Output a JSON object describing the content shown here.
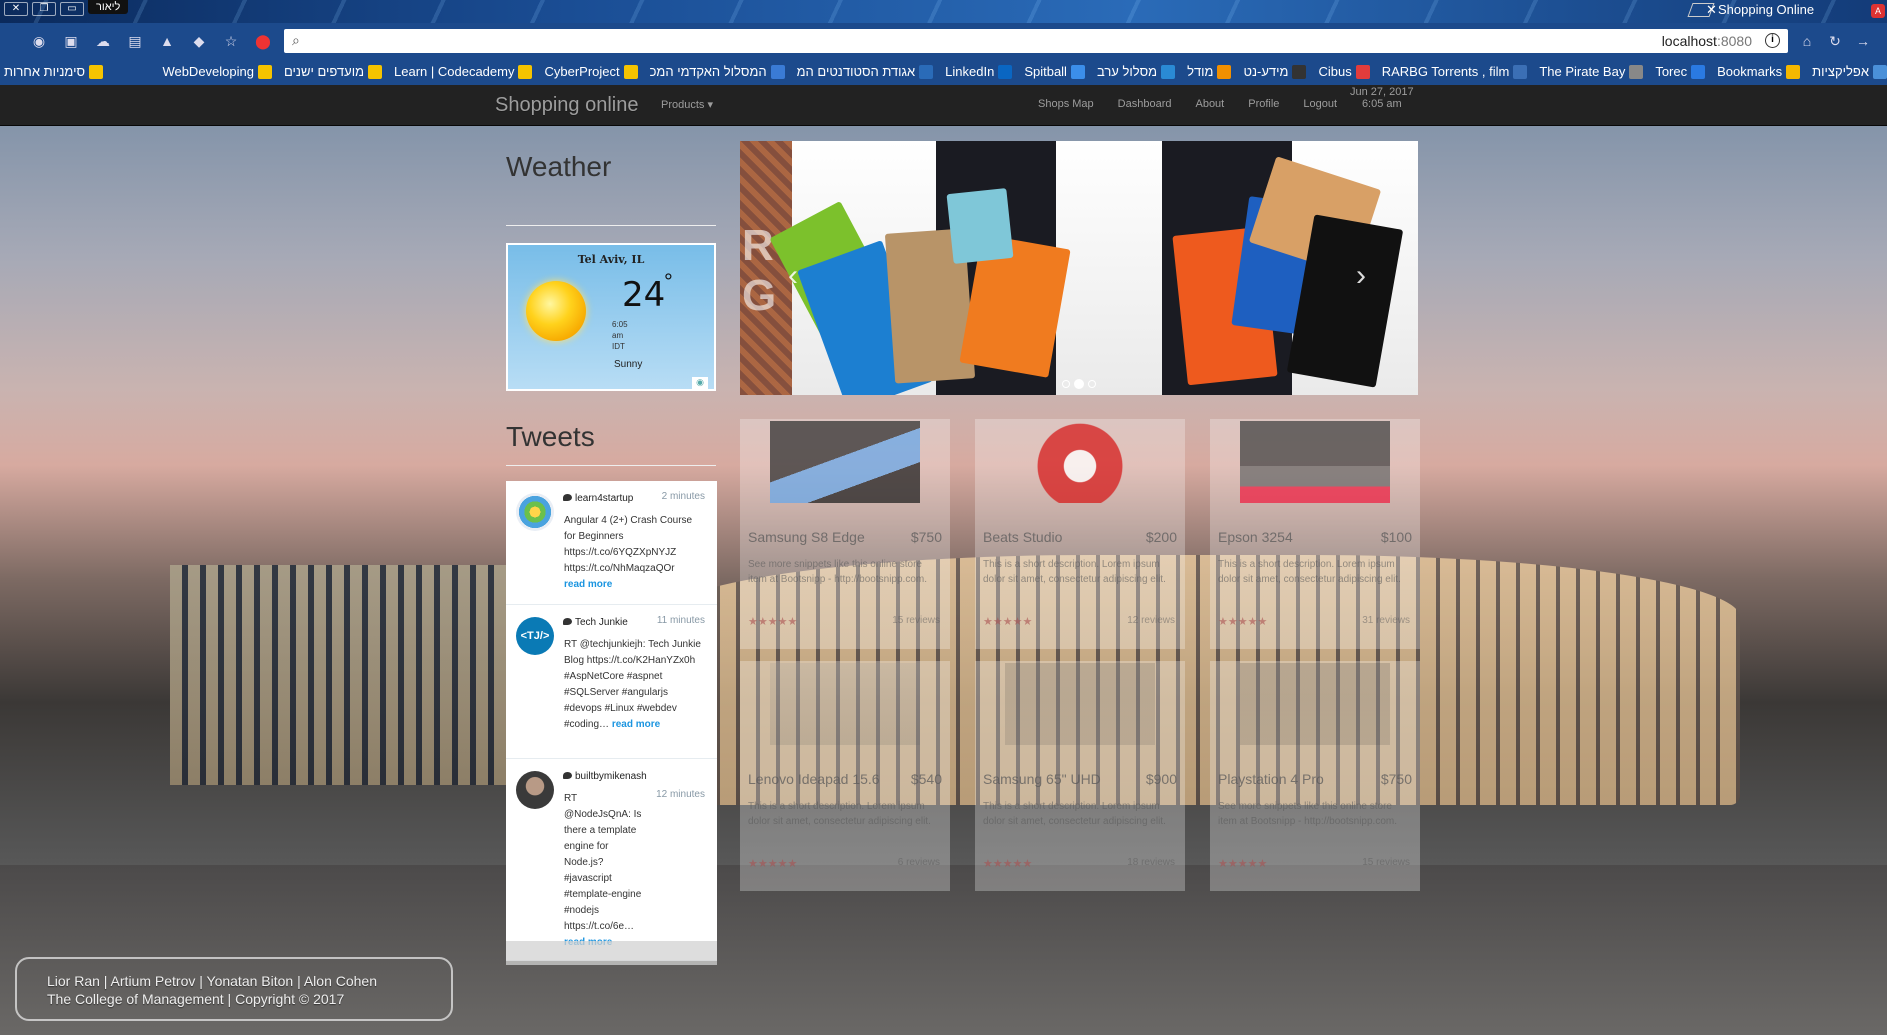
{
  "browser": {
    "profile_name": "ליאור",
    "tab_title": "Shopping Online",
    "url_host": "localhost",
    "url_port": ":8080",
    "bookmarks": [
      {
        "label": "אפליקציות",
        "icon_color": "#4a90d9"
      },
      {
        "label": "Bookmarks",
        "icon_color": "#f5b800"
      },
      {
        "label": "Torec",
        "icon_color": "#2a7ae2"
      },
      {
        "label": "The Pirate Bay",
        "icon_color": "#888888"
      },
      {
        "label": "RARBG Torrents , film",
        "icon_color": "#3b6fb5"
      },
      {
        "label": "Cibus",
        "icon_color": "#e23c3c"
      },
      {
        "label": "מידע-נט",
        "icon_color": "#333333"
      },
      {
        "label": "מודל",
        "icon_color": "#f29000"
      },
      {
        "label": "מסלול ערב",
        "icon_color": "#2a8ad4"
      },
      {
        "label": "Spitball",
        "icon_color": "#3b8eea"
      },
      {
        "label": "LinkedIn",
        "icon_color": "#0a66c2"
      },
      {
        "label": "אגודת הסטודנטים המ",
        "icon_color": "#2a6bb8"
      },
      {
        "label": "המסלול האקדמי המכ",
        "icon_color": "#3a7bd5"
      },
      {
        "label": "CyberProject",
        "icon_color": "#f5c400"
      },
      {
        "label": "Learn | Codecademy",
        "icon_color": "#f5c400"
      },
      {
        "label": "מועדפים ישנים",
        "icon_color": "#f5c400"
      },
      {
        "label": "WebDeveloping",
        "icon_color": "#f5c400"
      }
    ],
    "other_bookmarks": "סימניות אחרות"
  },
  "navbar": {
    "brand": "Shopping online",
    "products": "Products",
    "links": [
      "Shops Map",
      "Dashboard",
      "About",
      "Profile",
      "Logout"
    ],
    "date": "Jun 27, 2017",
    "time": "6:05 am"
  },
  "weather": {
    "title": "Weather",
    "city": "Tel Aviv, IL",
    "temp": "24",
    "degree": "°",
    "time_line1": "6:05",
    "time_line2": "am",
    "time_line3": "IDT",
    "condition": "Sunny"
  },
  "tweets": {
    "title": "Tweets",
    "items": [
      {
        "user": "learn4startup",
        "ago": "2 minutes",
        "text": "Angular 4 (2+) Crash Course for Beginners https://t.co/6YQZXpNYJZ https://t.co/NhMaqzaQOr",
        "more": "read more",
        "avatar_color": "#e9eef5"
      },
      {
        "user": "Tech Junkie",
        "ago": "11 minutes",
        "text": "RT @techjunkiejh: Tech Junkie Blog https://t.co/K2HanYZx0h #AspNetCore #aspnet #SQLServer #angularjs #devops #Linux #webdev #coding…",
        "more": "read more",
        "avatar_color": "#0a7ab5"
      },
      {
        "user": "builtbymikenash",
        "ago": "12 minutes",
        "text": "RT @NodeJsQnA: Is there a template engine for Node.js? #javascript #template-engine #nodejs https://t.co/6e…",
        "more": "read more",
        "avatar_color": "#3a3a3a"
      }
    ]
  },
  "products": [
    {
      "name": "Samsung S8 Edge",
      "price": "$750",
      "desc": "See more snippets like this online store item at Bootsnipp - http://bootsnipp.com.",
      "stars": "★★★★★",
      "reviews": "15 reviews"
    },
    {
      "name": "Beats Studio",
      "price": "$200",
      "desc": "This is a short description. Lorem ipsum dolor sit amet, consectetur adipiscing elit.",
      "stars": "★★★★★",
      "reviews": "12 reviews"
    },
    {
      "name": "Epson 3254",
      "price": "$100",
      "desc": "This is a short description. Lorem ipsum dolor sit amet, consectetur adipiscing elit.",
      "stars": "★★★★★",
      "reviews": "31 reviews"
    },
    {
      "name": "Lenovo Ideapad 15.6",
      "price": "$540",
      "desc": "This is a short description. Lorem ipsum dolor sit amet, consectetur adipiscing elit.",
      "stars": "★★★★★",
      "reviews": "6 reviews"
    },
    {
      "name": "Samsung 65\" UHD",
      "price": "$900",
      "desc": "This is a short description. Lorem ipsum dolor sit amet, consectetur adipiscing elit.",
      "stars": "★★★★★",
      "reviews": "18 reviews"
    },
    {
      "name": "Playstation 4 Pro",
      "price": "$750",
      "desc": "See more snippets like this online store item at Bootsnipp - http://bootsnipp.com.",
      "stars": "★★★★★",
      "reviews": "15 reviews"
    }
  ],
  "footer": {
    "line1": "Lior Ran | Artium Petrov | Yonatan Biton | Alon Cohen",
    "line2": "The College of Management | Copyright © 2017"
  }
}
